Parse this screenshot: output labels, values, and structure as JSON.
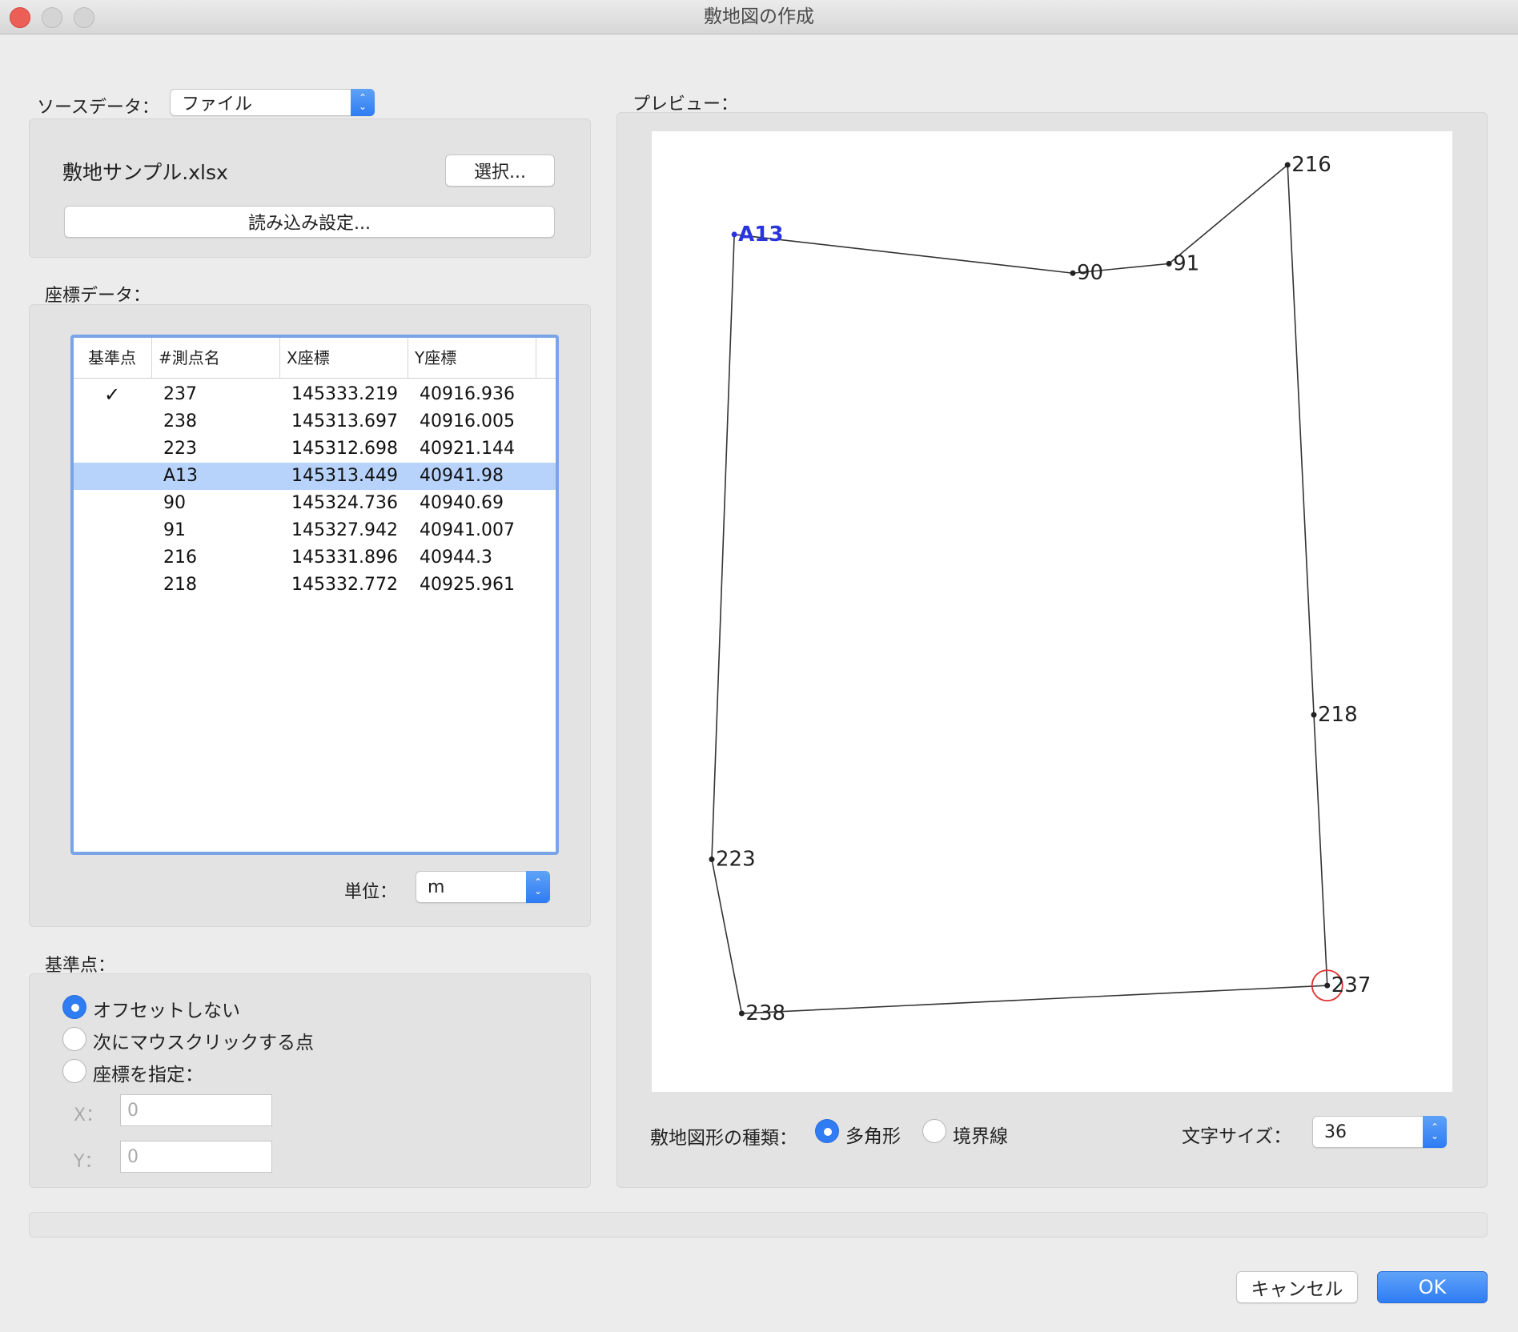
{
  "window": {
    "title": "敷地図の作成",
    "traffic_lights": {
      "close": "#ec5f57",
      "minimize": "#d0d0d0",
      "zoom": "#d0d0d0"
    }
  },
  "source": {
    "label": "ソースデータ：",
    "popup_value": "ファイル",
    "file_name": "敷地サンプル.xlsx",
    "select_button": "選択...",
    "import_settings_button": "読み込み設定..."
  },
  "coords": {
    "label": "座標データ：",
    "columns": [
      "基準点",
      "#測点名",
      "X座標",
      "Y座標"
    ],
    "rows": [
      {
        "base": "✓",
        "name": "237",
        "x": "145333.219",
        "y": "40916.936",
        "selected": false
      },
      {
        "base": "",
        "name": "238",
        "x": "145313.697",
        "y": "40916.005",
        "selected": false
      },
      {
        "base": "",
        "name": "223",
        "x": "145312.698",
        "y": "40921.144",
        "selected": false
      },
      {
        "base": "",
        "name": "A13",
        "x": "145313.449",
        "y": "40941.98",
        "selected": true
      },
      {
        "base": "",
        "name": "90",
        "x": "145324.736",
        "y": "40940.69",
        "selected": false
      },
      {
        "base": "",
        "name": "91",
        "x": "145327.942",
        "y": "40941.007",
        "selected": false
      },
      {
        "base": "",
        "name": "216",
        "x": "145331.896",
        "y": "40944.3",
        "selected": false
      },
      {
        "base": "",
        "name": "218",
        "x": "145332.772",
        "y": "40925.961",
        "selected": false
      }
    ],
    "unit_label": "単位：",
    "unit_value": "m"
  },
  "base_point": {
    "label": "基準点：",
    "options": [
      {
        "label": "オフセットしない",
        "selected": true
      },
      {
        "label": "次にマウスクリックする点",
        "selected": false
      },
      {
        "label": "座標を指定：",
        "selected": false
      }
    ],
    "x_label": "X：",
    "x_value": "0",
    "y_label": "Y：",
    "y_value": "0"
  },
  "preview": {
    "label": "プレビュー：",
    "highlight_color": "#2a33e0",
    "marker_color": "#e03030",
    "selected_point": "A13",
    "base_point": "237",
    "polygon_order": [
      "A13",
      "90",
      "91",
      "216",
      "218",
      "237",
      "238",
      "223"
    ]
  },
  "shape": {
    "label": "敷地図形の種類：",
    "options": [
      {
        "label": "多角形",
        "selected": true
      },
      {
        "label": "境界線",
        "selected": false
      }
    ],
    "font_size_label": "文字サイズ：",
    "font_size_value": "36"
  },
  "footer": {
    "cancel": "キャンセル",
    "ok": "OK",
    "accent": "#2f7cf3"
  }
}
